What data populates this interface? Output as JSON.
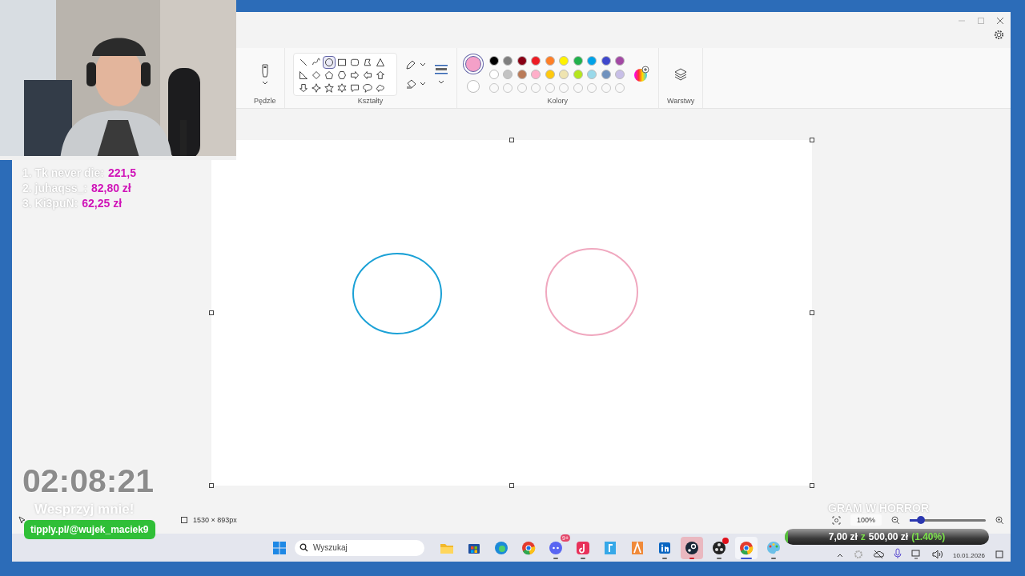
{
  "ribbon": {
    "groups": [
      {
        "kind": "brushes",
        "label": "Pędzle"
      },
      {
        "kind": "shapes",
        "label": "Kształty"
      },
      {
        "kind": "colors",
        "label": "Kolory"
      },
      {
        "kind": "layers",
        "label": "Warstwy"
      }
    ]
  },
  "shapes": [
    {
      "kind": "line",
      "selected": false
    },
    {
      "kind": "curve",
      "selected": false
    },
    {
      "kind": "oval",
      "selected": true
    },
    {
      "kind": "rect",
      "selected": false
    },
    {
      "kind": "rounded-rect",
      "selected": false
    },
    {
      "kind": "polygon",
      "selected": false
    },
    {
      "kind": "triangle",
      "selected": false
    },
    {
      "kind": "right-triangle",
      "selected": false
    },
    {
      "kind": "diamond",
      "selected": false
    },
    {
      "kind": "pentagon",
      "selected": false
    },
    {
      "kind": "hexagon",
      "selected": false
    },
    {
      "kind": "arrow-right",
      "selected": false
    },
    {
      "kind": "arrow-left",
      "selected": false
    },
    {
      "kind": "arrow-up",
      "selected": false
    },
    {
      "kind": "arrow-down",
      "selected": false
    },
    {
      "kind": "star4",
      "selected": false
    },
    {
      "kind": "star5",
      "selected": false
    },
    {
      "kind": "star6",
      "selected": false
    },
    {
      "kind": "callout-rect",
      "selected": false
    },
    {
      "kind": "callout-oval",
      "selected": false
    },
    {
      "kind": "callout-cloud",
      "selected": false
    }
  ],
  "colors": {
    "primary": {
      "color": "#f4a0c8"
    },
    "secondary": {
      "color": "#ffffff"
    },
    "palette": [
      {
        "color": "#000000"
      },
      {
        "color": "#7f7f7f"
      },
      {
        "color": "#880015"
      },
      {
        "color": "#ed1c24"
      },
      {
        "color": "#ff7f27"
      },
      {
        "color": "#fff200"
      },
      {
        "color": "#22b14c"
      },
      {
        "color": "#00a2e8"
      },
      {
        "color": "#3f48cc"
      },
      {
        "color": "#a349a4"
      },
      {
        "color": "#ffffff"
      },
      {
        "color": "#c3c3c3"
      },
      {
        "color": "#b97a57"
      },
      {
        "color": "#ffaec9"
      },
      {
        "color": "#ffc90e"
      },
      {
        "color": "#efe4b0"
      },
      {
        "color": "#b5e61d"
      },
      {
        "color": "#99d9ea"
      },
      {
        "color": "#7092be"
      },
      {
        "color": "#c8bfe7"
      }
    ]
  },
  "canvas": {
    "shapes": [
      {
        "kind": "ellipse",
        "color": "#1ba1d6"
      },
      {
        "kind": "ellipse",
        "color": "#f0a8bf"
      }
    ]
  },
  "status_bar": {
    "canvas_size": "1530 × 893px",
    "zoom": "100%",
    "zoom_slider": {
      "level": 0.15
    }
  },
  "taskbar": {
    "search_placeholder": "Wyszukaj",
    "date": "10.01.2026",
    "apps": [
      {
        "kind": "folder",
        "running": false,
        "selected": false,
        "alert": false,
        "focused": false
      },
      {
        "kind": "store",
        "running": false,
        "selected": false,
        "alert": false,
        "focused": false
      },
      {
        "kind": "edge",
        "running": false,
        "selected": false,
        "alert": false,
        "focused": false
      },
      {
        "kind": "chrome",
        "running": false,
        "selected": false,
        "alert": false,
        "focused": false
      },
      {
        "kind": "discord",
        "running": true,
        "selected": false,
        "alert": false,
        "focused": false,
        "badge": "9+"
      },
      {
        "kind": "tiktok",
        "running": true,
        "selected": false,
        "alert": false,
        "focused": false
      },
      {
        "kind": "tile-blue",
        "running": false,
        "selected": false,
        "alert": false,
        "focused": false
      },
      {
        "kind": "tile-orange",
        "running": false,
        "selected": false,
        "alert": false,
        "focused": false
      },
      {
        "kind": "linkedin",
        "running": true,
        "selected": false,
        "alert": false,
        "focused": false
      },
      {
        "kind": "steam",
        "running": true,
        "selected": true,
        "alert": false,
        "focused": false
      },
      {
        "kind": "obs",
        "running": true,
        "selected": false,
        "alert": true,
        "focused": false
      },
      {
        "kind": "chrome",
        "running": true,
        "selected": false,
        "alert": false,
        "focused": true
      },
      {
        "kind": "paint",
        "running": true,
        "selected": false,
        "alert": false,
        "focused": false
      }
    ]
  },
  "overlays": {
    "leaderboard": [
      {
        "name": "1. Tk never die:",
        "amount": "221,5"
      },
      {
        "name": "2. juhaqss_:",
        "amount": "82,80 zł"
      },
      {
        "name": "3. Ki3puN:",
        "amount": "62,25 zł"
      }
    ],
    "timer": "02:08:21",
    "support": "Wesprzyj mnie!",
    "link": "tipply.pl/@wujek_maciek9",
    "goal": {
      "title": "GRAM W HORROR",
      "current": "7,00 zł",
      "separator": "z",
      "target": "500,00 zł",
      "percent": "(1.40%)",
      "level": 0.014
    }
  }
}
